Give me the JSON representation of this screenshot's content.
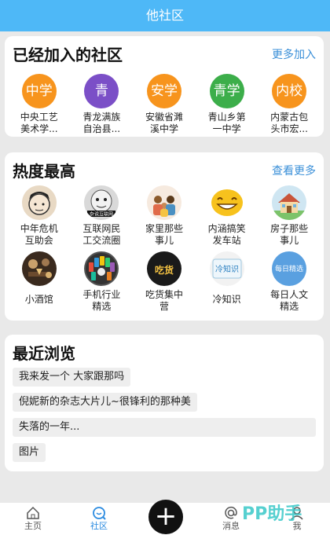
{
  "topbar": {
    "title": "他社区"
  },
  "joined": {
    "title": "已经加入的社区",
    "more": "更多加入",
    "items": [
      {
        "badge": "中学",
        "label1": "中央工艺",
        "label2": "美术学...",
        "color": "#f7941d"
      },
      {
        "badge": "青",
        "label1": "青龙满族",
        "label2": "自治县...",
        "color": "#7b4fc7"
      },
      {
        "badge": "安学",
        "label1": "安徽省濉",
        "label2": "溪中学",
        "color": "#f7941d"
      },
      {
        "badge": "青学",
        "label1": "青山乡第",
        "label2": "一中学",
        "color": "#3cae4a"
      },
      {
        "badge": "内校",
        "label1": "内蒙古包",
        "label2": "头市宏...",
        "color": "#f7941d"
      }
    ]
  },
  "hot": {
    "title": "热度最高",
    "more": "查看更多",
    "items": [
      {
        "icon": "cartoon-face-icon",
        "label1": "中年危机",
        "label2": "互助会"
      },
      {
        "icon": "meme-face-icon",
        "label1": "互联网民",
        "label2": "工交流圈",
        "caption": "杂说互联网"
      },
      {
        "icon": "family-icon",
        "label1": "家里那些",
        "label2": "事儿"
      },
      {
        "icon": "grin-emoji-icon",
        "label1": "内涵搞笑",
        "label2": "发车站"
      },
      {
        "icon": "house-icon",
        "label1": "房子那些",
        "label2": "事儿"
      },
      {
        "icon": "wine-bar-icon",
        "label1": "小酒馆",
        "label2": ""
      },
      {
        "icon": "phones-icon",
        "label1": "手机行业",
        "label2": "精选"
      },
      {
        "icon": "foodie-icon",
        "label1": "吃货集中",
        "label2": "营",
        "caption": "吃货"
      },
      {
        "icon": "trivia-icon",
        "label1": "冷知识",
        "label2": "",
        "caption": "冷知识"
      },
      {
        "icon": "daily-reading-icon",
        "label1": "每日人文",
        "label2": "精选",
        "caption": "每日精选"
      }
    ]
  },
  "recent": {
    "title": "最近浏览",
    "items": [
      "我来发一个  大家跟那吗",
      "倪妮新的杂志大片儿~很锋利的那种美",
      "失落的一年...",
      "图片"
    ]
  },
  "tabbar": {
    "items": [
      {
        "label": "主页",
        "icon": "home-icon"
      },
      {
        "label": "社区",
        "icon": "community-icon",
        "active": true
      },
      {
        "label": "",
        "icon": "plus-icon"
      },
      {
        "label": "消息",
        "icon": "at-icon"
      },
      {
        "label": "我",
        "icon": "person-icon"
      }
    ],
    "watermark": "PP助手"
  }
}
